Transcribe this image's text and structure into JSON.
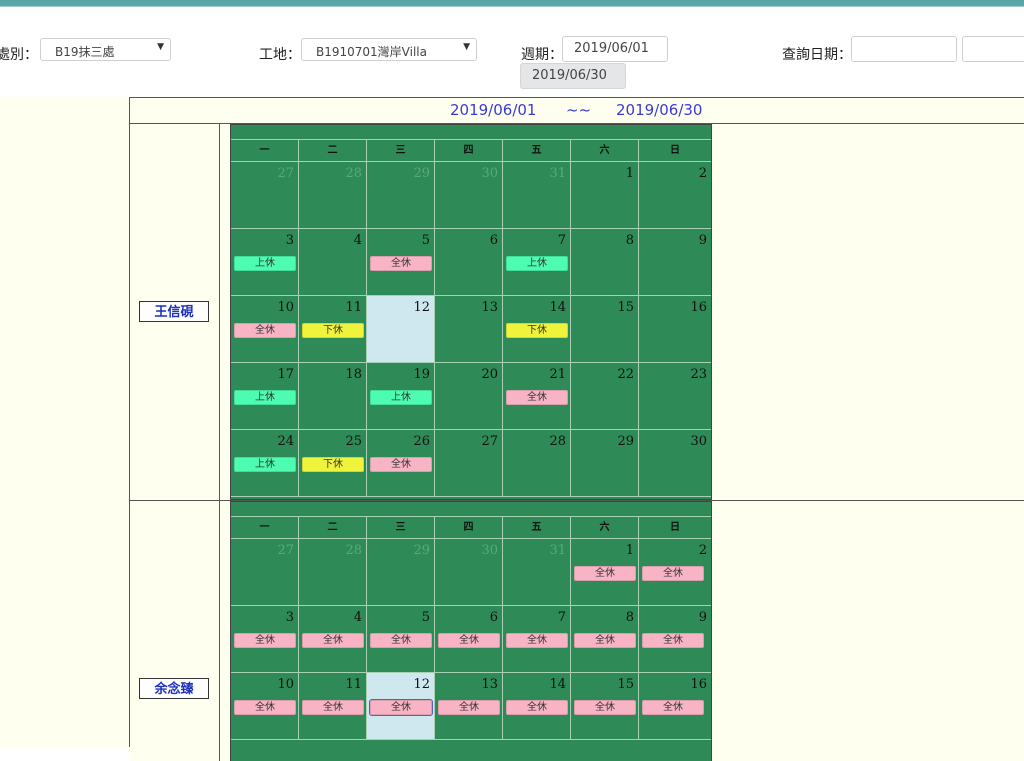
{
  "filters": {
    "division_label": "處別：",
    "division_value": "B19抹三處",
    "site_label": "工地：",
    "site_value": "B1910701灣岸Villa",
    "period_label": "週期：",
    "period_start": "2019/06/01",
    "period_end": "2019/06/30",
    "query_date_label": "查詢日期：",
    "query_date_from": "",
    "query_date_to": ""
  },
  "range": {
    "start": "2019/06/01",
    "separator": "~~",
    "end": "2019/06/30"
  },
  "weekdays": [
    "一",
    "二",
    "三",
    "四",
    "五",
    "六",
    "日"
  ],
  "leave_types": {
    "am": "上休",
    "pm": "下休",
    "full": "全休"
  },
  "colors": {
    "am": "#4dfcb1",
    "pm": "#eff33c",
    "full": "#f8b4c5",
    "calendar_bg": "#2e8b57",
    "today_bg": "#cfe7ef"
  },
  "employees": [
    {
      "name": "王信硯",
      "weeks": [
        [
          {
            "day": "27",
            "other": true
          },
          {
            "day": "28",
            "other": true
          },
          {
            "day": "29",
            "other": true
          },
          {
            "day": "30",
            "other": true
          },
          {
            "day": "31",
            "other": true
          },
          {
            "day": "1"
          },
          {
            "day": "2"
          }
        ],
        [
          {
            "day": "3",
            "leave": "上休",
            "type": "am"
          },
          {
            "day": "4"
          },
          {
            "day": "5",
            "leave": "全休",
            "type": "full"
          },
          {
            "day": "6"
          },
          {
            "day": "7",
            "leave": "上休",
            "type": "am"
          },
          {
            "day": "8"
          },
          {
            "day": "9"
          }
        ],
        [
          {
            "day": "10",
            "leave": "全休",
            "type": "full"
          },
          {
            "day": "11",
            "leave": "下休",
            "type": "pm"
          },
          {
            "day": "12",
            "today": true
          },
          {
            "day": "13"
          },
          {
            "day": "14",
            "leave": "下休",
            "type": "pm"
          },
          {
            "day": "15"
          },
          {
            "day": "16"
          }
        ],
        [
          {
            "day": "17",
            "leave": "上休",
            "type": "am"
          },
          {
            "day": "18"
          },
          {
            "day": "19",
            "leave": "上休",
            "type": "am"
          },
          {
            "day": "20"
          },
          {
            "day": "21",
            "leave": "全休",
            "type": "full"
          },
          {
            "day": "22"
          },
          {
            "day": "23"
          }
        ],
        [
          {
            "day": "24",
            "leave": "上休",
            "type": "am"
          },
          {
            "day": "25",
            "leave": "下休",
            "type": "pm"
          },
          {
            "day": "26",
            "leave": "全休",
            "type": "full"
          },
          {
            "day": "27"
          },
          {
            "day": "28"
          },
          {
            "day": "29"
          },
          {
            "day": "30"
          }
        ]
      ]
    },
    {
      "name": "余念臻",
      "weeks": [
        [
          {
            "day": "27",
            "other": true
          },
          {
            "day": "28",
            "other": true
          },
          {
            "day": "29",
            "other": true
          },
          {
            "day": "30",
            "other": true
          },
          {
            "day": "31",
            "other": true
          },
          {
            "day": "1",
            "leave": "全休",
            "type": "full"
          },
          {
            "day": "2",
            "leave": "全休",
            "type": "full"
          }
        ],
        [
          {
            "day": "3",
            "leave": "全休",
            "type": "full"
          },
          {
            "day": "4",
            "leave": "全休",
            "type": "full"
          },
          {
            "day": "5",
            "leave": "全休",
            "type": "full"
          },
          {
            "day": "6",
            "leave": "全休",
            "type": "full"
          },
          {
            "day": "7",
            "leave": "全休",
            "type": "full"
          },
          {
            "day": "8",
            "leave": "全休",
            "type": "full"
          },
          {
            "day": "9",
            "leave": "全休",
            "type": "full"
          }
        ],
        [
          {
            "day": "10",
            "leave": "全休",
            "type": "full"
          },
          {
            "day": "11",
            "leave": "全休",
            "type": "full"
          },
          {
            "day": "12",
            "leave": "全休",
            "type": "full",
            "today": true
          },
          {
            "day": "13",
            "leave": "全休",
            "type": "full"
          },
          {
            "day": "14",
            "leave": "全休",
            "type": "full"
          },
          {
            "day": "15",
            "leave": "全休",
            "type": "full"
          },
          {
            "day": "16",
            "leave": "全休",
            "type": "full"
          }
        ]
      ]
    }
  ]
}
